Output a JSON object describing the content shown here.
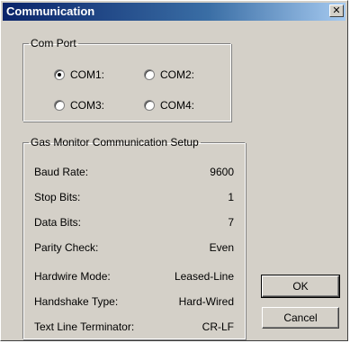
{
  "window": {
    "title": "Communication",
    "close_label": "✕"
  },
  "com_port": {
    "legend": "Com Port",
    "options": [
      {
        "label": "COM1:",
        "checked": true
      },
      {
        "label": "COM2:",
        "checked": false
      },
      {
        "label": "COM3:",
        "checked": false
      },
      {
        "label": "COM4:",
        "checked": false
      }
    ]
  },
  "setup": {
    "legend": "Gas Monitor Communication Setup",
    "rows": [
      {
        "label": "Baud Rate:",
        "value": "9600"
      },
      {
        "label": "Stop Bits:",
        "value": "1"
      },
      {
        "label": "Data Bits:",
        "value": "7"
      },
      {
        "label": "Parity Check:",
        "value": "Even"
      },
      {
        "label": "Hardwire Mode:",
        "value": "Leased-Line"
      },
      {
        "label": "Handshake Type:",
        "value": "Hard-Wired"
      },
      {
        "label": "Text Line Terminator:",
        "value": "CR-LF"
      }
    ]
  },
  "buttons": {
    "ok": "OK",
    "cancel": "Cancel"
  },
  "colors": {
    "titlebar_start": "#0a246a",
    "titlebar_end": "#a6caf0",
    "dialog_bg": "#d4d0c8"
  }
}
